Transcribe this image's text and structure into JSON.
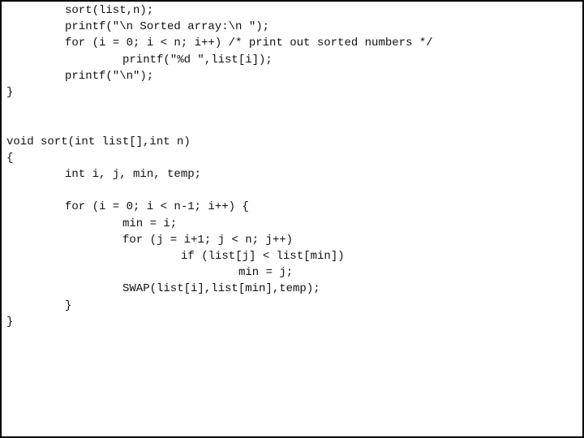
{
  "document": {
    "type": "code-listing",
    "language": "C",
    "lines": [
      {
        "indent": 1,
        "text": "sort(list,n);"
      },
      {
        "indent": 1,
        "text": "printf(\"\\n Sorted array:\\n \");"
      },
      {
        "indent": 1,
        "text": "for (i = 0; i < n; i++) /* print out sorted numbers */"
      },
      {
        "indent": 2,
        "text": "printf(\"%d \",list[i]);"
      },
      {
        "indent": 1,
        "text": "printf(\"\\n\");"
      },
      {
        "indent": 0,
        "text": "}"
      },
      {
        "indent": 0,
        "text": ""
      },
      {
        "indent": 0,
        "text": ""
      },
      {
        "indent": 0,
        "text": "void sort(int list[],int n)"
      },
      {
        "indent": 0,
        "text": "{"
      },
      {
        "indent": 1,
        "text": "int i, j, min, temp;"
      },
      {
        "indent": 0,
        "text": ""
      },
      {
        "indent": 1,
        "text": "for (i = 0; i < n-1; i++) {"
      },
      {
        "indent": 2,
        "text": "min = i;"
      },
      {
        "indent": 2,
        "text": "for (j = i+1; j < n; j++)"
      },
      {
        "indent": 3,
        "text": "if (list[j] < list[min])"
      },
      {
        "indent": 4,
        "text": "min = j;"
      },
      {
        "indent": 2,
        "text": "SWAP(list[i],list[min],temp);"
      },
      {
        "indent": 1,
        "text": "}"
      },
      {
        "indent": 0,
        "text": "}"
      }
    ]
  }
}
